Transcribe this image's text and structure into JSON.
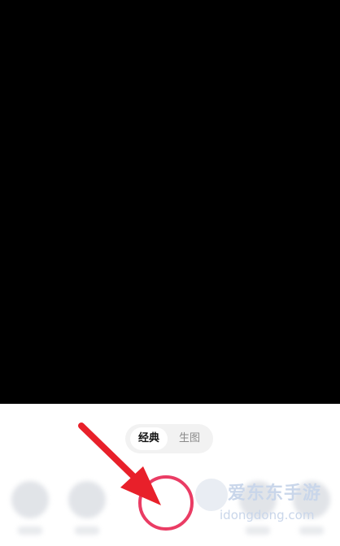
{
  "mode_switch": {
    "tabs": [
      {
        "label": "经典",
        "active": true
      },
      {
        "label": "生图",
        "active": false
      }
    ]
  },
  "watermark": {
    "title": "爱东东手游",
    "subtitle": "idongdong.com"
  },
  "colors": {
    "viewfinder": "#000000",
    "panel": "#ffffff",
    "shutter_ring": "#ea3c64",
    "arrow": "#e8202a"
  }
}
